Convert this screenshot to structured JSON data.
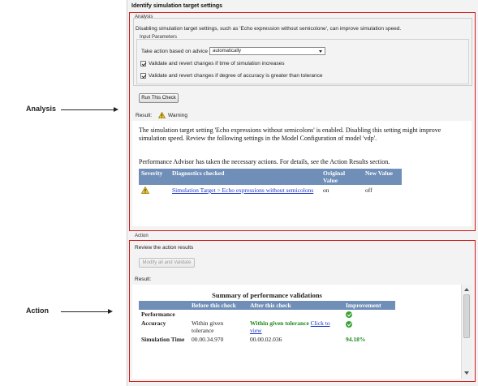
{
  "callouts": {
    "analysis": "Analysis",
    "action": "Action"
  },
  "panel": {
    "title": "Identify simulation target settings",
    "analysis_legend": "Analysis",
    "description": "Disabling simulation target settings, such as 'Echo expression without semicolone', can improve simulation speed.",
    "input_parameters_legend": "Input Parameters",
    "take_action_label": "Take action based on advice",
    "take_action_value": "automatically",
    "checkbox1_label": "Validate and revert changes if time of simulation increases",
    "checkbox2_label": "Validate and revert changes if degree of accuracy is greater than tolerance",
    "run_button": "Run This Check",
    "result_label": "Result:",
    "result_status": "Warning",
    "result_paragraph": "The simulation target setting 'Echo expressions without semicolons' is enabled. Disabling this setting might improve simulation speed. Review the following settings in the Model Configuration of model 'vdp'.",
    "advisor_paragraph": "Performance Advisor has taken the necessary actions. For details, see the Action Results section.",
    "diag_table": {
      "headers": [
        "Severity",
        "Diagnostics checked",
        "Original Value",
        "New Value"
      ],
      "rows": [
        {
          "diagnostic": "Simulation Target > Echo expressions without semicolons",
          "original": "on",
          "new": "off"
        }
      ]
    },
    "action_legend": "Action",
    "review_text": "Review the action results",
    "modify_button": "Modify all and Validate",
    "action_result_label": "Result:",
    "perf_table": {
      "title": "Summary of performance validations",
      "headers": [
        "",
        "Before this check",
        "After this check",
        "Improvement"
      ],
      "rows": [
        {
          "label": "Performance",
          "before": "",
          "after": "",
          "improvement_icon": "check-circle-icon"
        },
        {
          "label": "Accuracy",
          "before": "Within given tolerance",
          "after": "Within given tolerance",
          "after_link": "Click to view",
          "improvement_icon": "check-circle-icon"
        },
        {
          "label": "Simulation Time",
          "before": "00.00.34.970",
          "after": "00.00.02.036",
          "improvement": "94.18%"
        }
      ]
    }
  },
  "colors": {
    "highlight_border": "#d01818",
    "table_header": "#6f8fb8",
    "link": "#1a35c8",
    "success": "#1e8a1e"
  }
}
